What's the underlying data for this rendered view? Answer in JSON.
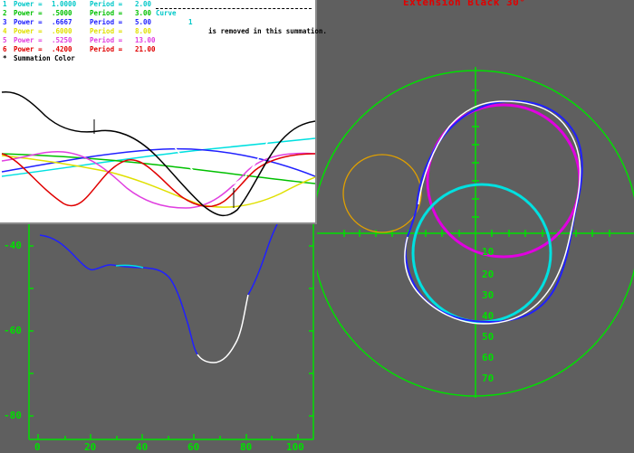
{
  "title": "Extension Black 30°",
  "legend": {
    "rows": [
      {
        "num": "1",
        "power_label": "Power =",
        "power": "1.0000",
        "period_label": "Period =",
        "period": "2.00",
        "color": "#00c8c8"
      },
      {
        "num": "2",
        "power_label": "Power =",
        "power": ".5000",
        "period_label": "Period =",
        "period": "3.00",
        "color": "#00c000"
      },
      {
        "num": "3",
        "power_label": "Power =",
        "power": ".6667",
        "period_label": "Period =",
        "period": "5.00",
        "color": "#2020ff"
      },
      {
        "num": "4",
        "power_label": "Power =",
        "power": ".6000",
        "period_label": "Period =",
        "period": "8.00",
        "color": "#e0e000"
      },
      {
        "num": "5",
        "power_label": "Power =",
        "power": ".5250",
        "period_label": "Period =",
        "period": "13.00",
        "color": "#e040e0"
      },
      {
        "num": "6",
        "power_label": "Power =",
        "power": ".4200",
        "period_label": "Period =",
        "period": "21.00",
        "color": "#e00000"
      }
    ],
    "summation": {
      "marker": "*",
      "label": "Summation Color"
    },
    "curve_note": {
      "label": "Curve",
      "num": "1",
      "text": "is removed in this summation."
    }
  },
  "colors": {
    "green": "#00e000",
    "background": "#5f5f5f",
    "circle_orange": "#e0a000",
    "circle_cyan": "#00e0e0",
    "circle_magenta": "#e000e0",
    "trace_blue": "#2020ff",
    "trace_white": "#ffffff"
  },
  "left_plot": {
    "y_ticks": [
      "-40",
      "-60",
      "-80"
    ],
    "x_ticks": [
      "0",
      "20",
      "40",
      "60",
      "80",
      "100"
    ]
  },
  "polar_plot": {
    "radial_ticks": [
      "10",
      "20",
      "30",
      "40",
      "50",
      "60",
      "70"
    ]
  }
}
